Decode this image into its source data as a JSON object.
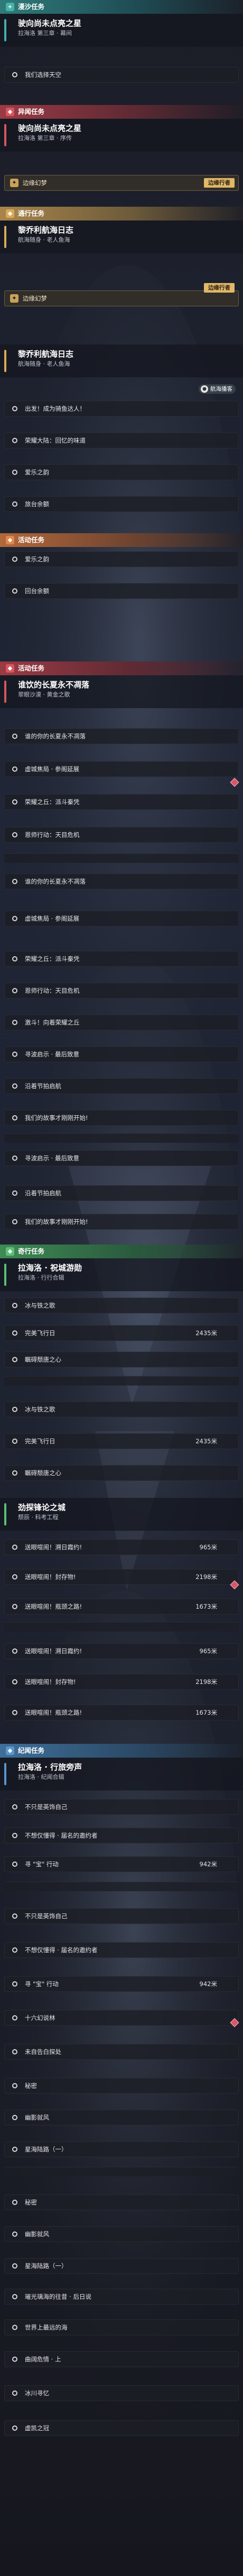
{
  "headers": {
    "jianghu": {
      "label": "漫沙任务",
      "icon": "+"
    },
    "yiwen": {
      "label": "异闻任务",
      "icon": "◆"
    },
    "tongxing1": {
      "label": "通行任务",
      "icon": "◆"
    },
    "huodong": {
      "label": "活动任务",
      "icon": "◆"
    },
    "huodong2": {
      "label": "活动任务",
      "icon": "◆"
    },
    "zhandou": {
      "label": "奇行任务",
      "icon": "◆"
    },
    "jiwen": {
      "label": "纪闻任务",
      "icon": "◆"
    }
  },
  "quests": {
    "q1": {
      "title": "驶向尚未点亮之星",
      "sub": "拉海洛 第三章 · 幕间"
    },
    "q2": {
      "title": "驶向尚未点亮之星",
      "sub": "拉海洛 第三章 · 序传"
    },
    "q3": {
      "title": "黎乔利航海日志",
      "sub": "航海随身 · 老人鱼海"
    },
    "q4": {
      "title": "黎乔利航海日志",
      "sub": "航海随身 · 老人鱼海"
    },
    "q5": {
      "title": "谁饮的长夏永不凋落",
      "sub": "翠眼沙漠 · 黄金之歌"
    },
    "q6": {
      "title": "拉海洛 · 祝城游勋",
      "sub": "拉海洛 · 行行合辑"
    },
    "q7": {
      "title": "劲探锋论之城",
      "sub": "颓辰 · 科考工程"
    },
    "q8": {
      "title": "拉海洛 · 行旅旁声",
      "sub": "拉海洛 · 纪闻合辑"
    }
  },
  "steps": {
    "s1": "我们选择天空",
    "g1": "边缘幻梦",
    "g2": "边缘幻梦",
    "s2": "出发！成为骑鱼达人！",
    "s3": "荣耀大陆：回忆的味道",
    "s4": "爱乐之韵",
    "s5": "旅台余额",
    "s6": "爱乐之韵",
    "s7": "回台余额",
    "s8": "谁的你的长夏永不凋落",
    "s9": "虚城焦局 · 参阁延展",
    "s10": "荣耀之丘：派斗秦凭",
    "s11": "恩师行动：天目危机",
    "s12": "谁的你的长夏永不凋落",
    "s13": "虚城焦局 · 参阁延展",
    "s14": "荣耀之丘：派斗秦凭",
    "s15": "恩师行动：天目危机",
    "s16": "激斗！向着荣耀之丘",
    "s17": "寻波启示 · 最后致意",
    "s18": "沿着节拍启航",
    "s19": "我们的故事才刚刚开始!",
    "s20": "寻波启示 · 最后致意",
    "s21": "沿着节拍启航",
    "s22": "我们的故事才刚刚开始!",
    "s23": "冰与铁之歌",
    "s24": "完美飞行日",
    "s25": "瞩碍颓唐之心",
    "s26": "冰与铁之歌",
    "s27": "完美飞行日",
    "s28": "瞩碍颓唐之心",
    "s29": "送眼喧闹！溯日霞约!",
    "s30": "送眼喧闹！封存物!",
    "s31": "送眼喧闹！瓶颈之路!",
    "s32": "送眼喧闹！溯日霞约!",
    "s33": "送眼喧闹！封存物!",
    "s34": "送眼喧闹！瓶颈之路!",
    "s35": "不只是英饰自己",
    "s36": "不想仅懂得 · 届名的邀约者",
    "s37": "寻 \"宝\" 行动",
    "s38": "不只是英饰自己",
    "s39": "不想仅懂得 · 届名的邀约者",
    "s40": "寻 \"宝\" 行动",
    "s41": "十六幻说林",
    "s42": "未自告白探处",
    "s43": "秘密",
    "s44": "幽影就风",
    "s45": "星海陆路（一）",
    "s46": "秘密",
    "s47": "幽影就风",
    "s48": "星海陆路（一）",
    "s49": "璀光璃海的往昔 · 后日说",
    "s50": "世界上最远的海",
    "s51": "曲阔危情 · 上",
    "s52": "冰川寻忆",
    "s53": "虚凯之冠"
  },
  "distances": {
    "d24": "2435米",
    "d27": "2435米",
    "d29": "965米",
    "d30": "2198米",
    "d31": "1673米",
    "d32": "965米",
    "d33": "2198米",
    "d34": "1673米",
    "d37": "942米",
    "d40": "942米"
  },
  "tags": {
    "t1": "边缘行者",
    "t2": "边缘行者",
    "t3": "航海播客"
  },
  "colors": {
    "teal": "#2f7b7a",
    "gold": "#a9854b",
    "red": "#9b3a44",
    "green": "#3f8a55",
    "blue": "#3f6f9a"
  }
}
